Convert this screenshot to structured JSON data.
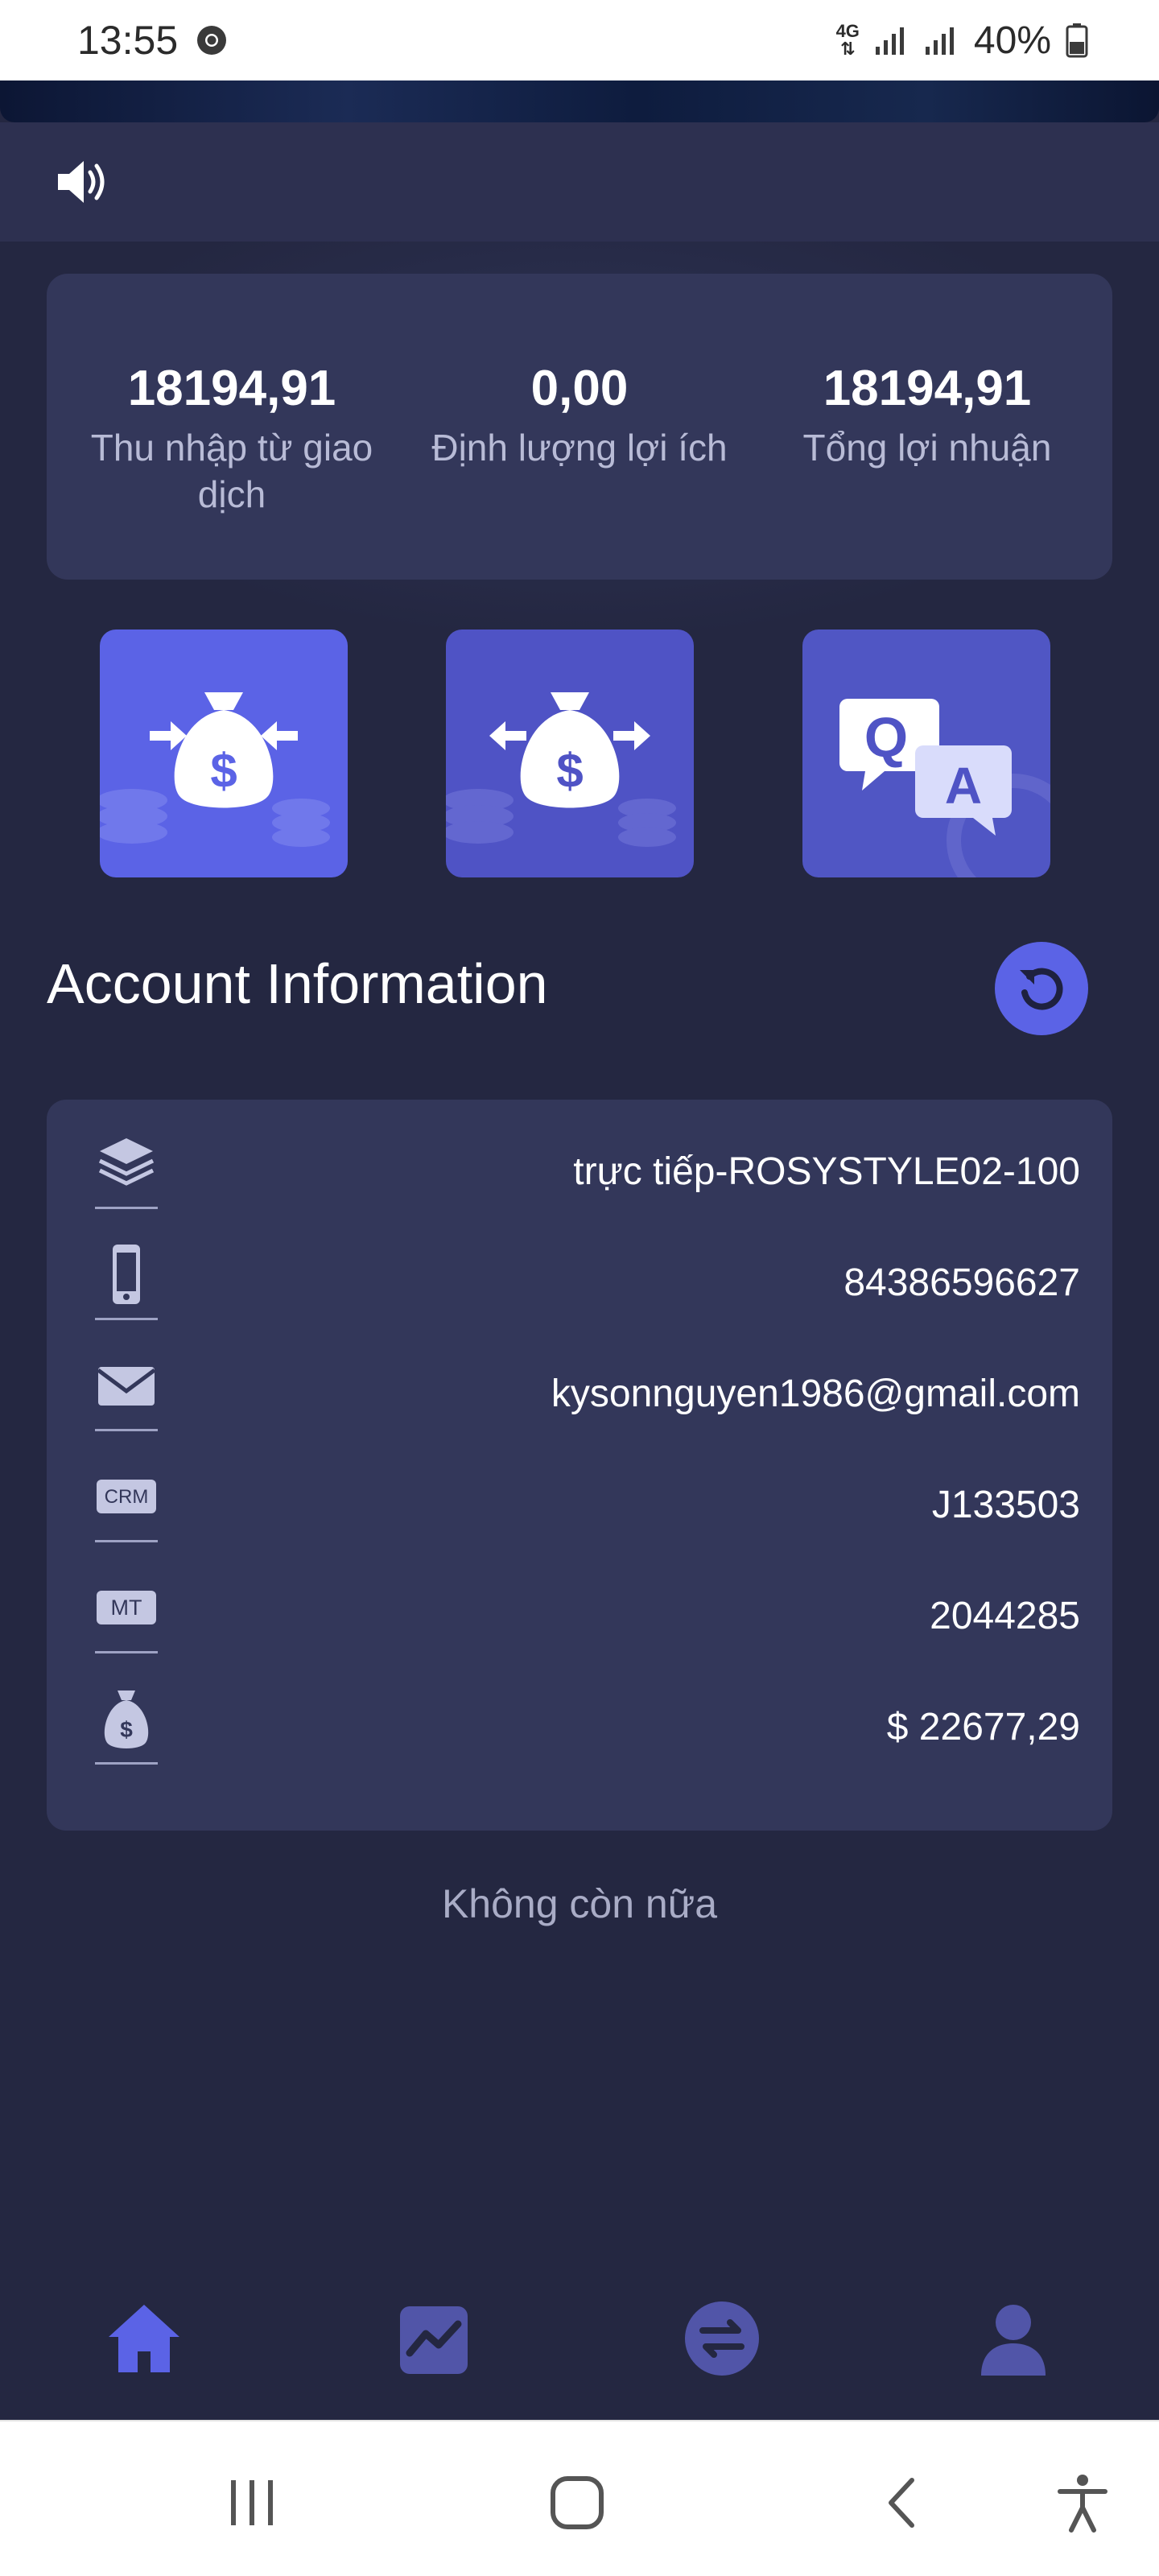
{
  "status_bar": {
    "time": "13:55",
    "network": "4G",
    "battery": "40%"
  },
  "summary": {
    "items": [
      {
        "value": "18194,91",
        "label": "Thu nhập từ giao dịch"
      },
      {
        "value": "0,00",
        "label": "Định lượng lợi ích"
      },
      {
        "value": "18194,91",
        "label": "Tổng lợi nhuận"
      }
    ]
  },
  "tiles": {
    "qa_q": "Q",
    "qa_a": "A"
  },
  "account": {
    "title": "Account Information",
    "rows": [
      {
        "icon": "layers-icon",
        "value": "trực tiếp-ROSYSTYLE02-100"
      },
      {
        "icon": "phone-icon",
        "value": "84386596627"
      },
      {
        "icon": "mail-icon",
        "value": "kysonnguyen1986@gmail.com"
      },
      {
        "icon": "crm-icon",
        "icon_text": "CRM",
        "value": "J133503"
      },
      {
        "icon": "mt-icon",
        "icon_text": "MT",
        "value": "2044285"
      },
      {
        "icon": "money-bag-icon",
        "value": "$ 22677,29"
      }
    ],
    "footer": "Không còn nữa"
  },
  "tab_bar": {
    "items": [
      "home-icon",
      "chart-icon",
      "exchange-icon",
      "user-icon"
    ],
    "active": "home-icon"
  },
  "colors": {
    "accent": "#5b63e6",
    "background": "#242741",
    "card": "#33375a"
  }
}
